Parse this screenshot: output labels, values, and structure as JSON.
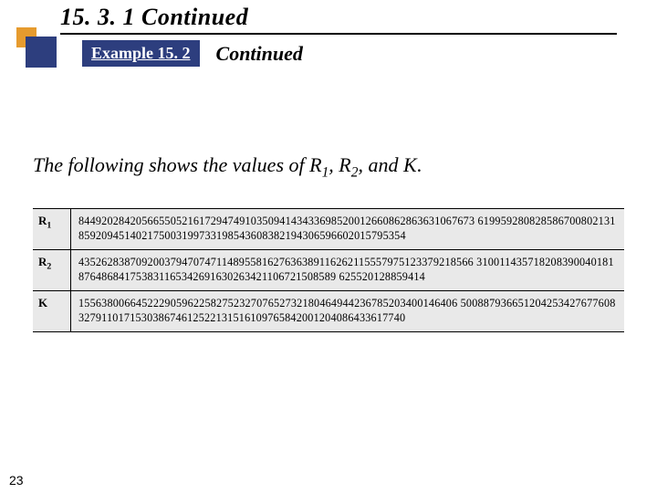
{
  "header": {
    "section_number": "15. 3. 1",
    "section_suffix": "Continued",
    "example_label": "Example 15. 2",
    "example_suffix": "Continued"
  },
  "body": {
    "intro_prefix": "The following shows the values of ",
    "r1": "R",
    "r1_sub": "1",
    "sep1": ", ",
    "r2": "R",
    "r2_sub": "2",
    "sep2": ", and ",
    "k": "K",
    "suffix": "."
  },
  "table": {
    "rows": [
      {
        "label_main": "R",
        "label_sub": "1",
        "value": "844920284205665505216172947491035094143433698520012660862863631067673 619959280828586700802131859209451402175003199733198543608382194306596602015795354"
      },
      {
        "label_main": "R",
        "label_sub": "2",
        "value": "435262838709200379470747114895581627636389116262115557975123379218566 310011435718208390040181876486841753831165342691630263421106721508589 625520128859414"
      },
      {
        "label_main": "K",
        "label_sub": "",
        "value": "155638006645222905962258275232707652732180464944236785203400146406 500887936651204253427677608327911017153038674612522131516109765842001204086433617740"
      }
    ]
  },
  "page_number": "23"
}
